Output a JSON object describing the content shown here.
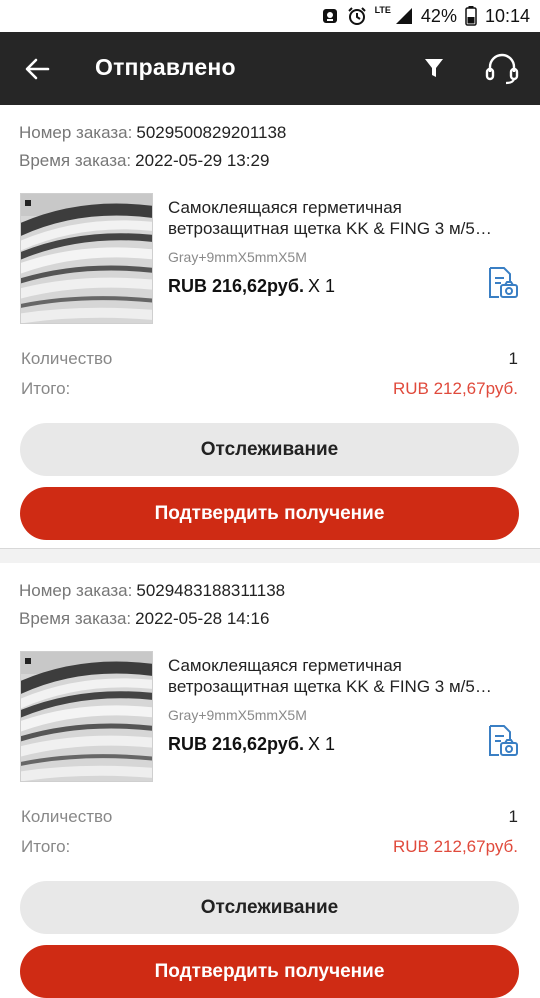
{
  "status_bar": {
    "network": "LTE",
    "battery": "42%",
    "time": "10:14"
  },
  "header": {
    "title": "Отправлено",
    "icons": [
      "back-arrow-icon",
      "filter-icon",
      "headset-icon"
    ]
  },
  "labels": {
    "order_number": "Номер заказа:",
    "order_time": "Время заказа:",
    "quantity": "Количество",
    "total": "Итого:",
    "tracking_button": "Отслеживание",
    "confirm_button": "Подтвердить получение"
  },
  "orders": [
    {
      "number": "5029500829201138",
      "time": "2022-05-29 13:29",
      "product_title_line1": "Самоклеящаяся герметичная",
      "product_title_line2": "ветрозащитная щетка KK & FING 3 м/5…",
      "sku": "Gray+9mmX5mmX5M",
      "price": "RUB 216,62руб.",
      "qty_x": "X 1",
      "quantity": "1",
      "total": "RUB 212,67руб."
    },
    {
      "number": "5029483188311138",
      "time": "2022-05-28 14:16",
      "product_title_line1": "Самоклеящаяся герметичная",
      "product_title_line2": "ветрозащитная щетка KK & FING 3 м/5…",
      "sku": "Gray+9mmX5mmX5M",
      "price": "RUB 216,62руб.",
      "qty_x": "X 1",
      "quantity": "1",
      "total": "RUB 212,67руб."
    }
  ],
  "colors": {
    "appbar": "#262626",
    "accent_red": "#cf2b14",
    "total_red": "#e04a3c",
    "review_icon_blue": "#3a7fc4"
  }
}
